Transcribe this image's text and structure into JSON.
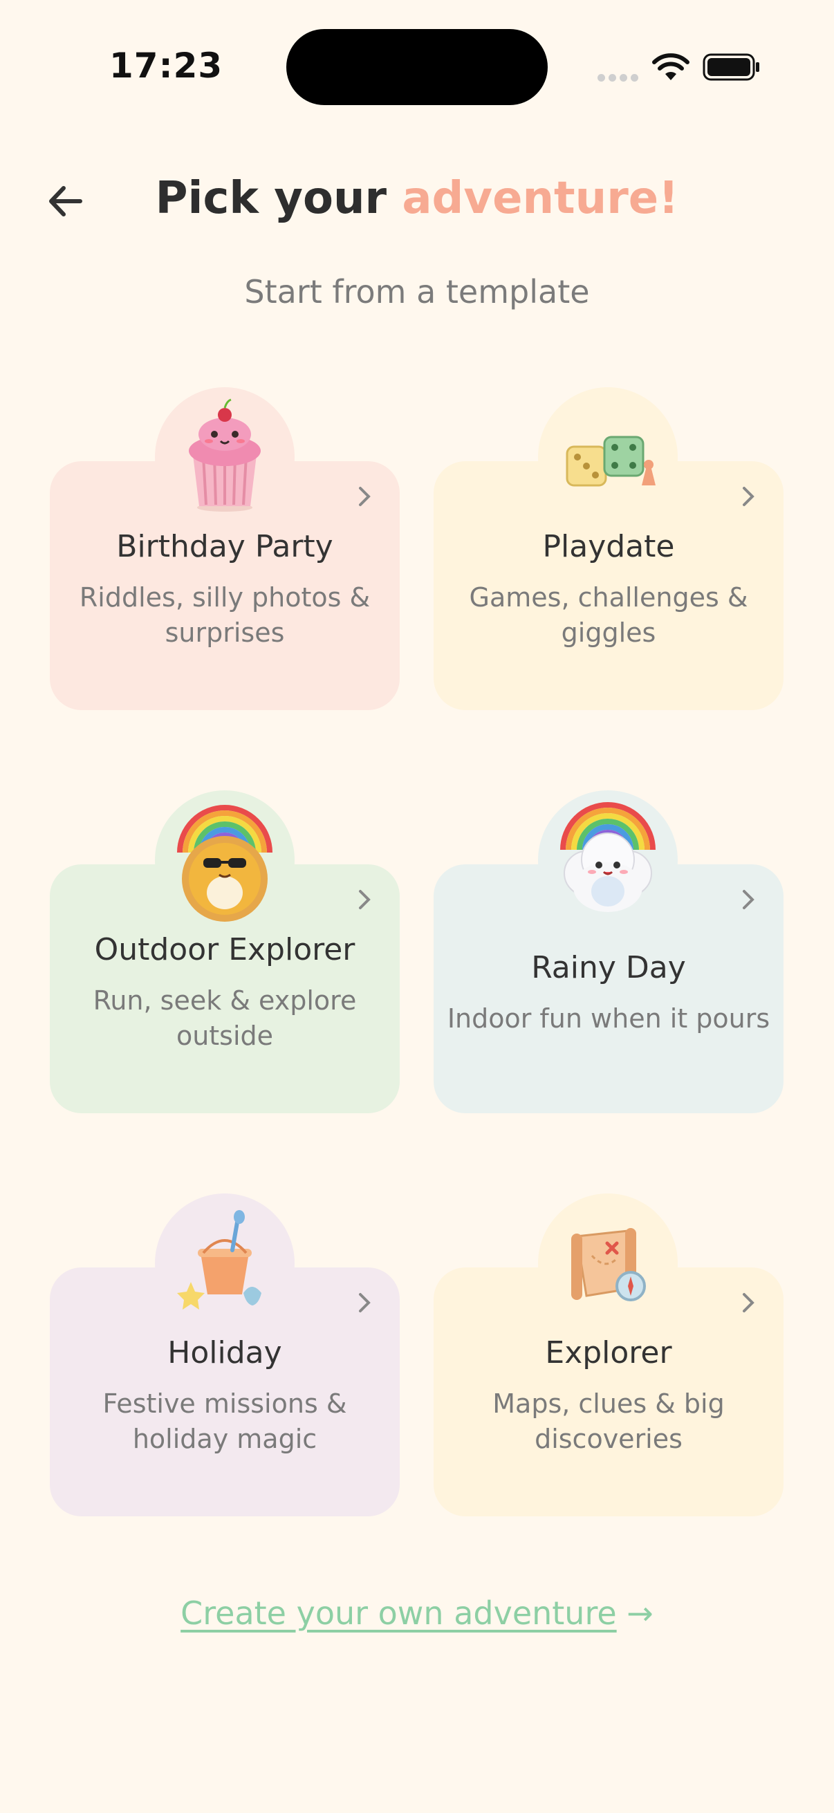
{
  "status_bar": {
    "time": "17:23"
  },
  "header": {
    "title_main": "Pick your",
    "title_accent": "adventure!",
    "subtitle": "Start from a template"
  },
  "templates": [
    {
      "title": "Birthday Party",
      "desc_line1": "Riddles, silly photos &",
      "desc_line2": "surprises",
      "icon": "cupcake-icon"
    },
    {
      "title": "Playdate",
      "desc_line1": "Games, challenges &",
      "desc_line2": "giggles",
      "icon": "dice-icon"
    },
    {
      "title": "Outdoor Explorer",
      "desc_line1": "Run, seek & explore",
      "desc_line2": "outside",
      "icon": "sun-rainbow-icon"
    },
    {
      "title": "Rainy Day",
      "desc_line1": "Indoor fun when it pours",
      "desc_line2": "",
      "icon": "cloud-rainbow-icon"
    },
    {
      "title": "Holiday",
      "desc_line1": "Festive missions &",
      "desc_line2": "holiday magic",
      "icon": "sand-bucket-icon"
    },
    {
      "title": "Explorer",
      "desc_line1": "Maps, clues & big",
      "desc_line2": "discoveries",
      "icon": "treasure-map-icon"
    }
  ],
  "footer": {
    "create_label": "Create your own adventure",
    "arrow": "→"
  },
  "colors": {
    "background": "#FFF8EE",
    "accent": "#F7AA92",
    "link": "#8DCFA4"
  }
}
